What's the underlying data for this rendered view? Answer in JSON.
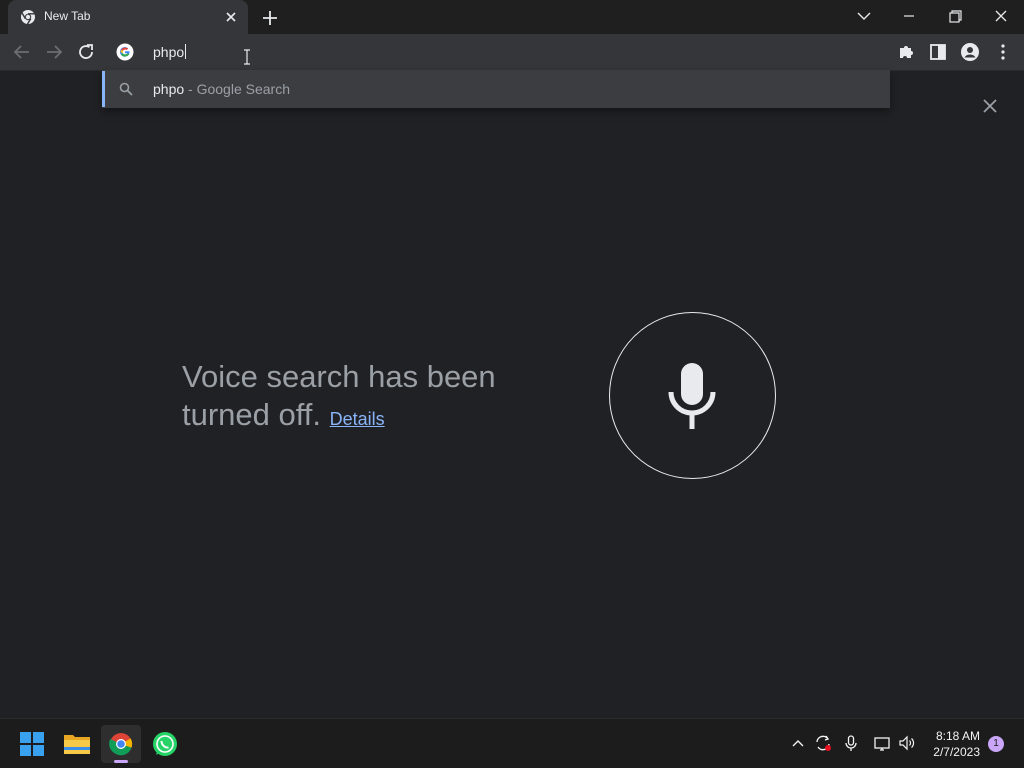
{
  "tab": {
    "title": "New Tab"
  },
  "omnibox": {
    "value": "phpo"
  },
  "suggestion": {
    "query": "phpo",
    "suffix": " - Google Search"
  },
  "voice": {
    "message": "Voice search has been turned off.",
    "details_label": "Details"
  },
  "taskbar": {
    "apps": [
      "start-icon",
      "file-explorer-icon",
      "chrome-icon",
      "whatsapp-icon"
    ],
    "clock_time": "8:18 AM",
    "clock_date": "2/7/2023",
    "notification_count": "1"
  },
  "colors": {
    "background": "#202124",
    "toolbar": "#35363a",
    "accent": "#8ab4f8",
    "text_secondary": "#9aa0a6"
  }
}
